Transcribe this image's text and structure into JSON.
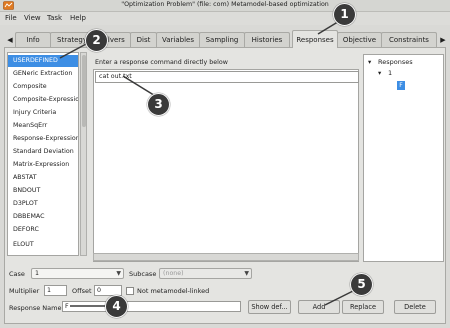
{
  "window": {
    "title": "\"Optimization Problem\" (file: com)   Metamodel-based optimization",
    "app_icon": "app-icon"
  },
  "menu": {
    "file": "File",
    "view": "View",
    "task": "Task",
    "help": "Help"
  },
  "tabs": [
    {
      "label": "Info"
    },
    {
      "label": "Strategy"
    },
    {
      "label": "Solvers"
    },
    {
      "label": "Dist"
    },
    {
      "label": "Variables"
    },
    {
      "label": "Sampling"
    },
    {
      "label": "Histories"
    },
    {
      "label": "Responses",
      "active": true
    },
    {
      "label": "Objective"
    },
    {
      "label": "Constraints"
    }
  ],
  "tab_arrows": {
    "left": "◀",
    "right": "▶"
  },
  "response_types": [
    "USERDEFINED",
    "GENeric Extraction",
    "Composite",
    "Composite-Expression",
    "Injury Criteria",
    "MeanSqErr",
    "Response-Expression",
    "Standard Deviation",
    "Matrix-Expression",
    "ABSTAT",
    "BNDOUT",
    "D3PLOT",
    "DBBEMAC",
    "DEFORC",
    "ELOUT"
  ],
  "command": {
    "prompt": "Enter a response command directly below",
    "value": "cat out.txt"
  },
  "tree": {
    "root": "Responses",
    "child": "1",
    "leaf": "F"
  },
  "bottom": {
    "case_label": "Case",
    "case_value": "1",
    "subcase_label": "Subcase",
    "subcase_value": "(none)",
    "multiplier_label": "Multiplier",
    "multiplier_value": "1",
    "offset_label": "Offset",
    "offset_value": "0",
    "not_metamodel_label": "Not metamodel-linked",
    "response_name_label": "Response Name",
    "response_name_value": "F"
  },
  "buttons": {
    "show_def": "Show def...",
    "add": "Add",
    "replace": "Replace",
    "delete": "Delete"
  },
  "callouts": [
    "1",
    "2",
    "3",
    "4",
    "5"
  ],
  "colors": {
    "selection": "#3d8ee4",
    "callout": "#3a3a3a"
  }
}
